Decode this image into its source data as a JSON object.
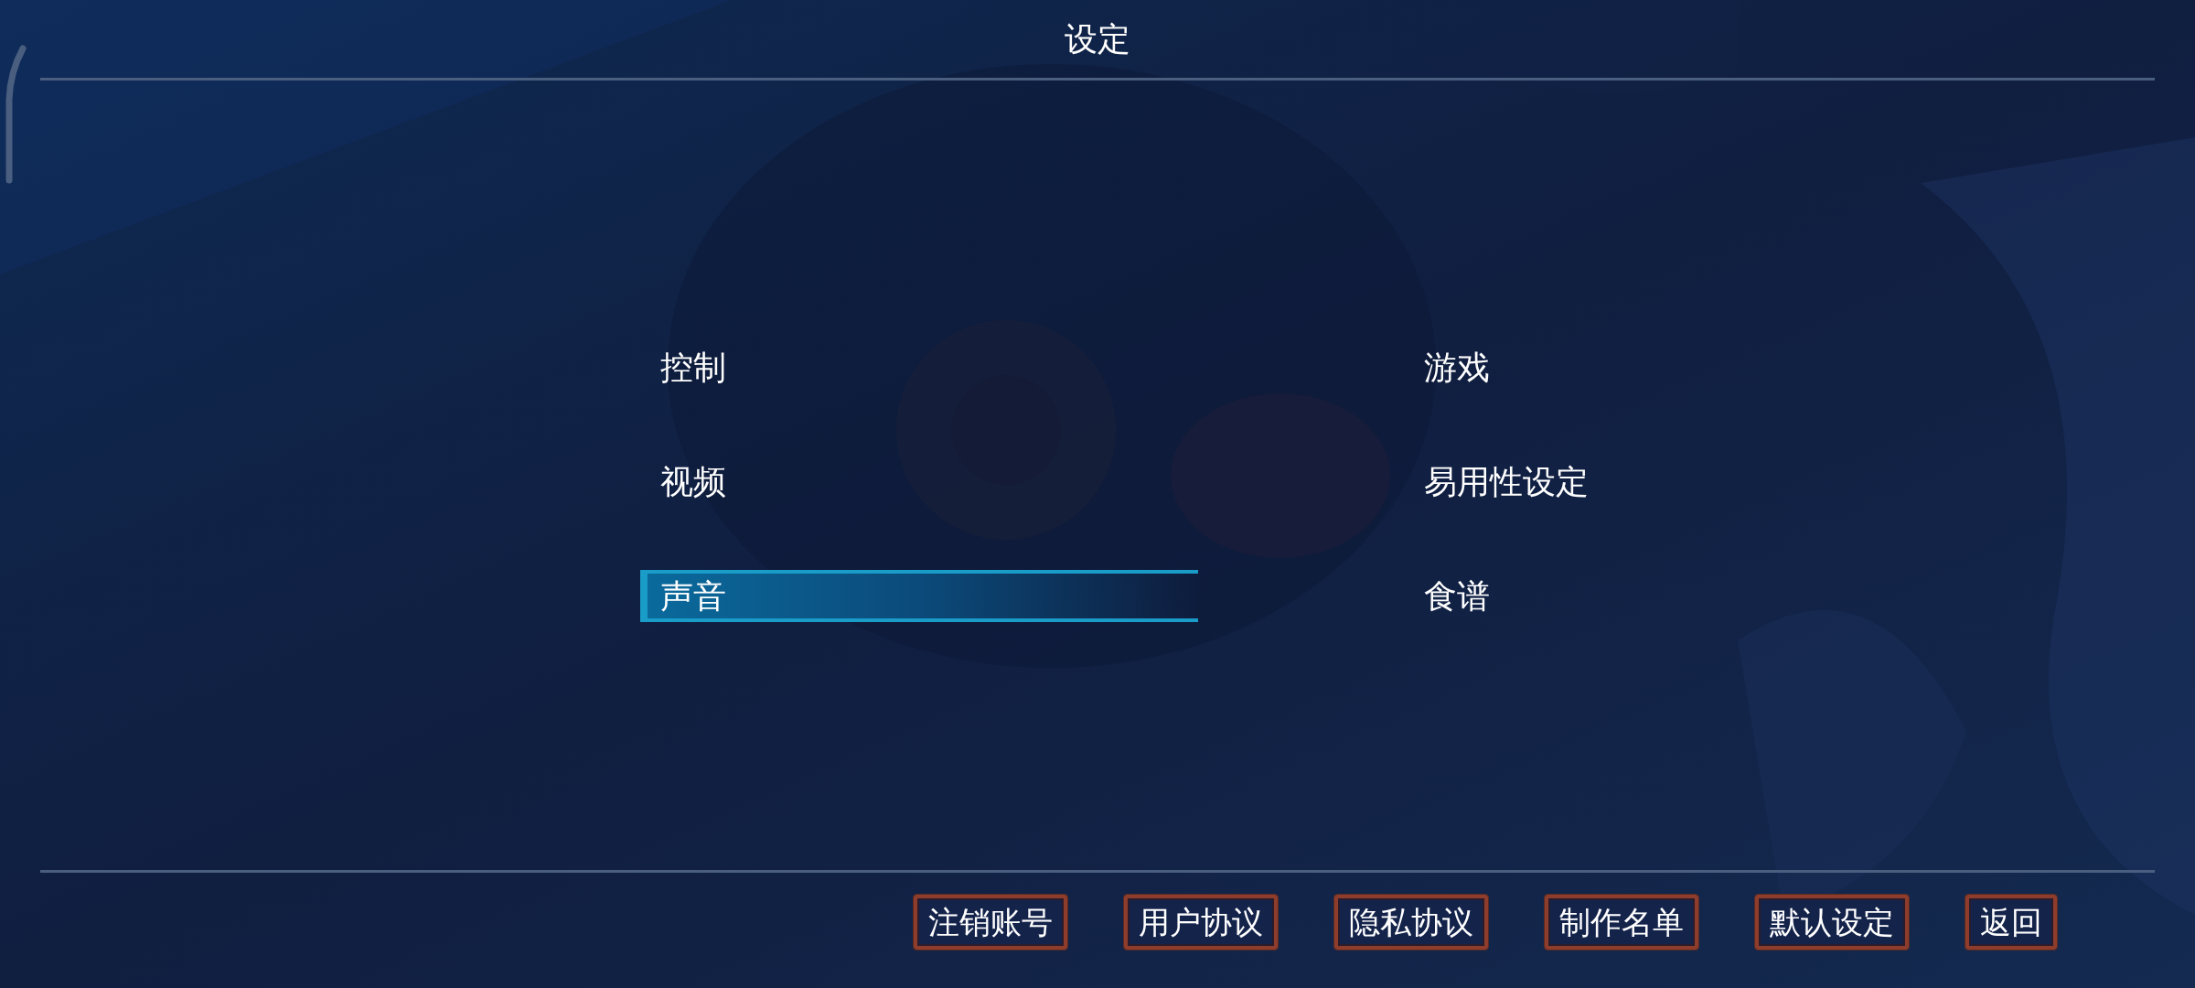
{
  "header": {
    "title": "设定"
  },
  "menu": [
    {
      "label": "控制",
      "selected": false
    },
    {
      "label": "游戏",
      "selected": false
    },
    {
      "label": "视频",
      "selected": false
    },
    {
      "label": "易用性设定",
      "selected": false
    },
    {
      "label": "声音",
      "selected": true
    },
    {
      "label": "食谱",
      "selected": false
    }
  ],
  "buttons": [
    "注销账号",
    "用户协议",
    "隐私协议",
    "制作名单",
    "默认设定",
    "返回"
  ]
}
